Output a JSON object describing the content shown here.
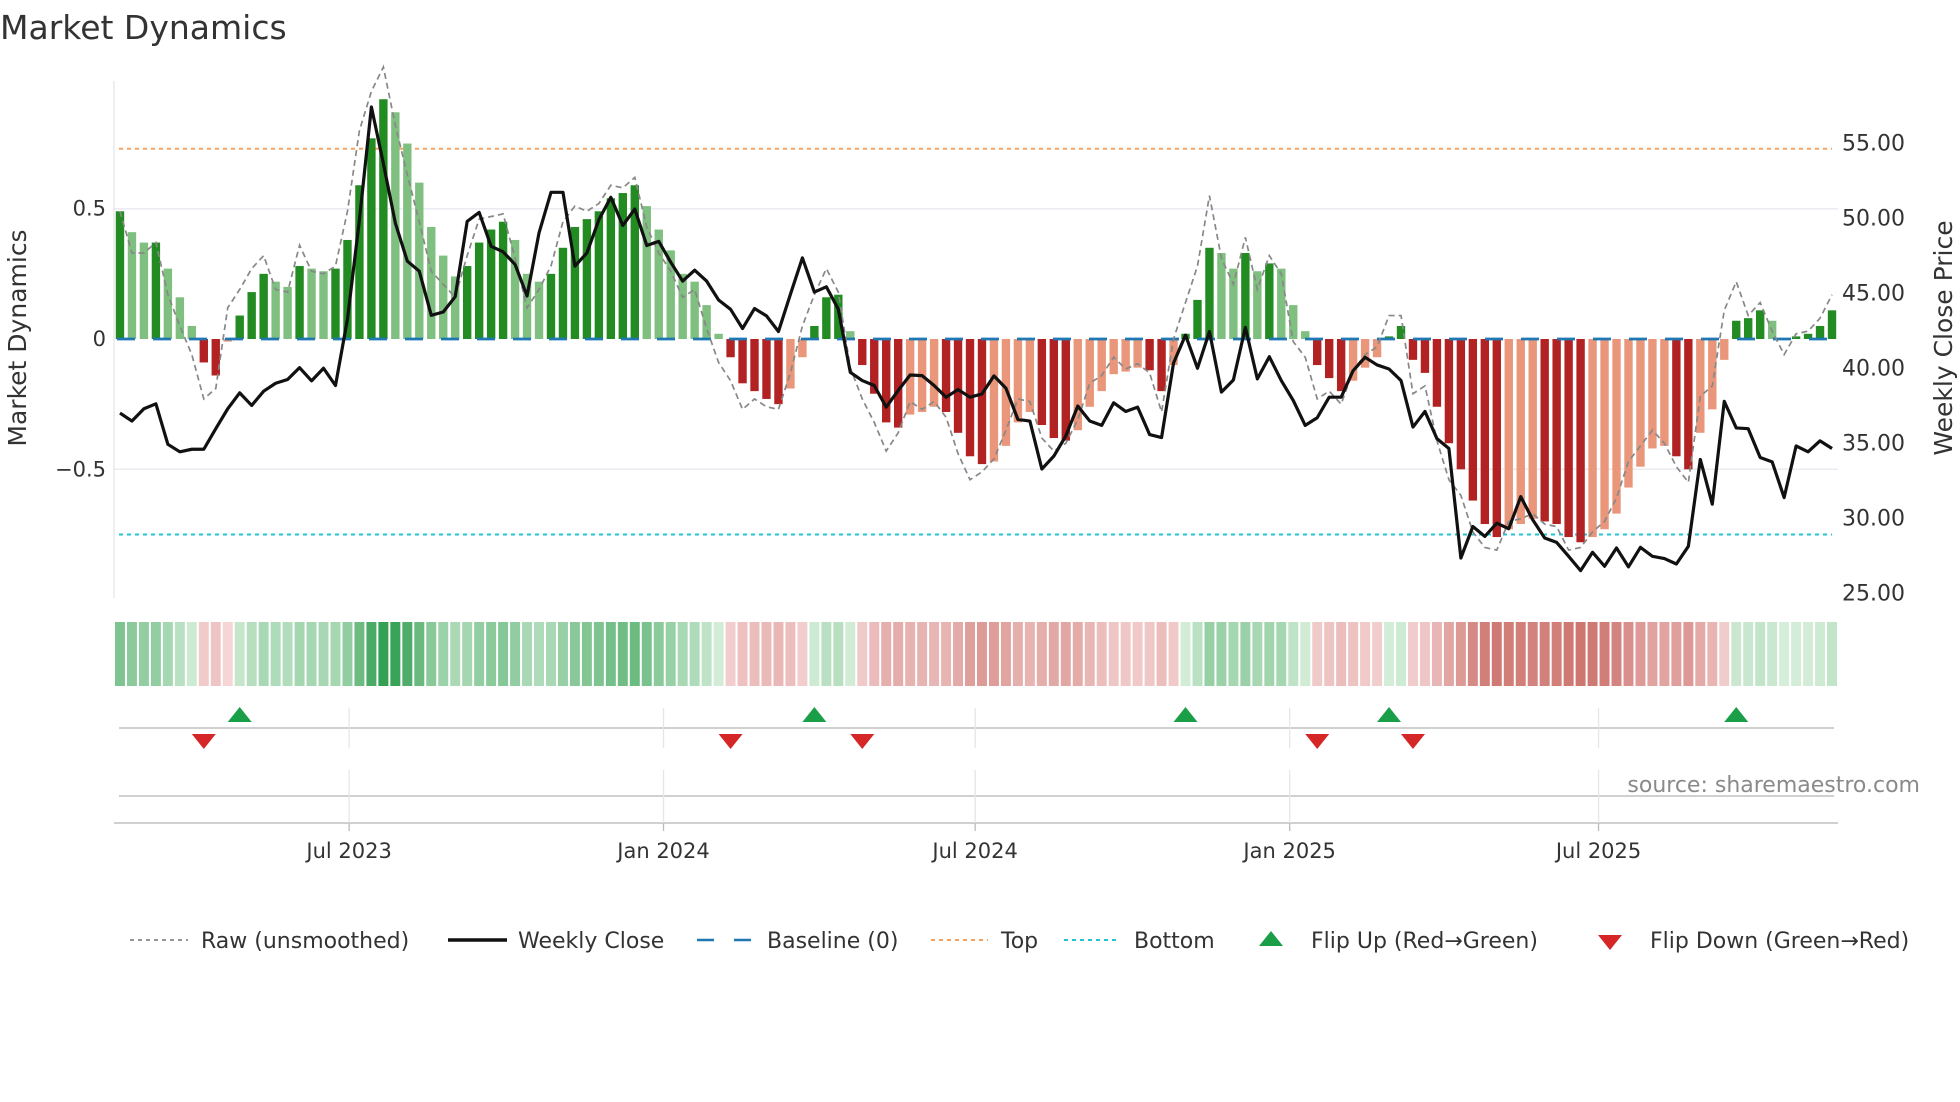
{
  "title": "Market Dynamics",
  "source": "source: sharemaestro.com",
  "legend": {
    "raw": "Raw (unsmoothed)",
    "close": "Weekly Close",
    "baseline": "Baseline (0)",
    "top": "Top",
    "bottom": "Bottom",
    "flip_up": "Flip Up (Red→Green)",
    "flip_down": "Flip Down (Green→Red)"
  },
  "colors": {
    "up_strong": "#228b22",
    "up_weak": "#7fbf7f",
    "down_strong": "#b22222",
    "down_weak": "#e9967a",
    "baseline": "#1f77b4",
    "top": "#f4a261",
    "bottom": "#22c3d6",
    "raw": "#888888",
    "close": "#111111",
    "flip_up": "#1a9e48",
    "flip_down": "#d62728"
  },
  "chart_data": {
    "type": "bar",
    "title": "Market Dynamics",
    "ylabel": "Market Dynamics",
    "y2label": "Weekly Close Price",
    "ylim": [
      -0.99,
      0.99
    ],
    "y2lim": [
      24.7,
      59.1
    ],
    "yticks": [
      {
        "v": 0.5,
        "label": "0.5"
      },
      {
        "v": 0,
        "label": "0"
      },
      {
        "v": -0.5,
        "label": "−0.5"
      }
    ],
    "y2ticks": [
      {
        "v": 55,
        "label": "55.00"
      },
      {
        "v": 50,
        "label": "50.00"
      },
      {
        "v": 45,
        "label": "45.00"
      },
      {
        "v": 40,
        "label": "40.00"
      },
      {
        "v": 35,
        "label": "35.00"
      },
      {
        "v": 30,
        "label": "30.00"
      },
      {
        "v": 25,
        "label": "25.00"
      }
    ],
    "xticks": [
      {
        "week": 19.64,
        "label": "Jul 2023"
      },
      {
        "week": 45.9,
        "label": "Jan 2024"
      },
      {
        "week": 71.93,
        "label": "Jul 2024"
      },
      {
        "week": 98.2,
        "label": "Jan 2025"
      },
      {
        "week": 124.0,
        "label": "Jul 2025"
      }
    ],
    "top_level": 0.73,
    "bottom_level": -0.75,
    "baseline": 0,
    "momentum": [
      0.49,
      0.41,
      0.37,
      0.37,
      0.27,
      0.16,
      0.05,
      -0.09,
      -0.14,
      -0.01,
      0.09,
      0.18,
      0.25,
      0.22,
      0.2,
      0.28,
      0.27,
      0.26,
      0.27,
      0.38,
      0.59,
      0.77,
      0.92,
      0.87,
      0.75,
      0.6,
      0.43,
      0.32,
      0.24,
      0.28,
      0.37,
      0.42,
      0.45,
      0.38,
      0.25,
      0.22,
      0.25,
      0.35,
      0.43,
      0.46,
      0.49,
      0.54,
      0.56,
      0.59,
      0.51,
      0.42,
      0.34,
      0.25,
      0.22,
      0.13,
      0.02,
      -0.07,
      -0.17,
      -0.2,
      -0.23,
      -0.25,
      -0.19,
      -0.07,
      0.05,
      0.16,
      0.17,
      0.03,
      -0.1,
      -0.21,
      -0.32,
      -0.34,
      -0.29,
      -0.28,
      -0.26,
      -0.28,
      -0.36,
      -0.45,
      -0.48,
      -0.47,
      -0.41,
      -0.32,
      -0.28,
      -0.33,
      -0.38,
      -0.39,
      -0.35,
      -0.26,
      -0.2,
      -0.135,
      -0.125,
      -0.11,
      -0.12,
      -0.2,
      -0.1,
      0.02,
      0.15,
      0.35,
      0.33,
      0.27,
      0.33,
      0.26,
      0.29,
      0.27,
      0.13,
      0.03,
      -0.1,
      -0.15,
      -0.2,
      -0.16,
      -0.11,
      -0.07,
      0.01,
      0.05,
      -0.08,
      -0.13,
      -0.26,
      -0.4,
      -0.5,
      -0.62,
      -0.71,
      -0.76,
      -0.73,
      -0.71,
      -0.69,
      -0.7,
      -0.71,
      -0.76,
      -0.78,
      -0.76,
      -0.73,
      -0.67,
      -0.57,
      -0.49,
      -0.42,
      -0.41,
      -0.45,
      -0.5,
      -0.36,
      -0.27,
      -0.08,
      0.07,
      0.08,
      0.11,
      0.07,
      0.003,
      0.01,
      0.02,
      0.05,
      0.11
    ],
    "raw": [
      0.49,
      0.33,
      0.33,
      0.37,
      0.17,
      0.05,
      -0.06,
      -0.23,
      -0.19,
      0.12,
      0.19,
      0.27,
      0.32,
      0.19,
      0.18,
      0.36,
      0.26,
      0.25,
      0.28,
      0.49,
      0.8,
      0.95,
      1.07,
      0.82,
      0.63,
      0.45,
      0.26,
      0.21,
      0.16,
      0.32,
      0.46,
      0.47,
      0.48,
      0.31,
      0.12,
      0.19,
      0.28,
      0.45,
      0.51,
      0.49,
      0.52,
      0.59,
      0.58,
      0.62,
      0.43,
      0.33,
      0.26,
      0.16,
      0.19,
      0.04,
      -0.09,
      -0.16,
      -0.27,
      -0.23,
      -0.26,
      -0.27,
      -0.13,
      0.05,
      0.17,
      0.27,
      0.18,
      -0.11,
      -0.23,
      -0.32,
      -0.43,
      -0.36,
      -0.24,
      -0.27,
      -0.24,
      -0.3,
      -0.44,
      -0.54,
      -0.51,
      -0.46,
      -0.35,
      -0.23,
      -0.24,
      -0.38,
      -0.43,
      -0.4,
      -0.31,
      -0.17,
      -0.14,
      -0.07,
      -0.115,
      -0.095,
      -0.13,
      -0.28,
      0.0,
      0.14,
      0.28,
      0.55,
      0.31,
      0.21,
      0.39,
      0.19,
      0.32,
      0.25,
      -0.01,
      -0.07,
      -0.23,
      -0.2,
      -0.25,
      -0.12,
      -0.06,
      -0.03,
      0.09,
      0.09,
      -0.21,
      -0.18,
      -0.39,
      -0.54,
      -0.6,
      -0.74,
      -0.8,
      -0.81,
      -0.7,
      -0.69,
      -0.67,
      -0.71,
      -0.72,
      -0.81,
      -0.8,
      -0.74,
      -0.7,
      -0.61,
      -0.47,
      -0.41,
      -0.35,
      -0.4,
      -0.49,
      -0.55,
      -0.22,
      -0.18,
      0.11,
      0.22,
      0.09,
      0.14,
      0.03,
      -0.06,
      0.02,
      0.03,
      0.08,
      0.17
    ],
    "weekly_close": [
      36.96,
      36.43,
      37.25,
      37.58,
      34.88,
      34.38,
      34.55,
      34.55,
      35.92,
      37.25,
      38.31,
      37.47,
      38.42,
      38.95,
      39.2,
      39.99,
      39.11,
      39.95,
      38.8,
      43.22,
      49.85,
      57.37,
      53.6,
      49.63,
      47.09,
      46.42,
      43.48,
      43.7,
      44.72,
      49.74,
      50.34,
      48.08,
      47.71,
      46.87,
      44.77,
      48.97,
      51.68,
      51.68,
      46.76,
      47.64,
      49.85,
      51.35,
      49.47,
      50.56,
      48.13,
      48.41,
      47.02,
      45.76,
      46.49,
      45.76,
      44.5,
      43.88,
      42.6,
      43.93,
      43.44,
      42.4,
      44.88,
      47.31,
      45.03,
      45.38,
      43.88,
      39.68,
      39.13,
      38.8,
      37.36,
      38.47,
      39.5,
      39.46,
      38.8,
      38.02,
      38.53,
      38.02,
      38.24,
      39.44,
      38.62,
      36.54,
      36.43,
      33.23,
      34.09,
      35.44,
      37.43,
      36.43,
      36.14,
      37.65,
      37.07,
      37.36,
      35.53,
      35.33,
      40.3,
      42.16,
      39.95,
      42.4,
      38.36,
      39.17,
      42.67,
      39.24,
      40.72,
      39.13,
      37.8,
      36.14,
      36.65,
      38.02,
      38.02,
      39.79,
      40.68,
      40.17,
      39.9,
      39.13,
      36.03,
      37.07,
      35.26,
      34.6,
      27.3,
      29.4,
      28.74,
      29.62,
      29.25,
      31.39,
      29.85,
      28.63,
      28.34,
      27.41,
      26.46,
      27.68,
      26.75,
      27.97,
      26.71,
      28.01,
      27.41,
      27.26,
      26.9,
      28.08,
      33.87,
      30.89,
      37.74,
      35.97,
      35.92,
      34.0,
      33.71,
      31.33,
      34.77,
      34.38,
      35.11,
      34.6
    ],
    "flip_up_weeks": [
      10,
      58,
      89,
      106,
      135
    ],
    "flip_down_weeks": [
      7,
      51,
      62,
      100,
      108
    ],
    "legend_position": "bottom"
  }
}
